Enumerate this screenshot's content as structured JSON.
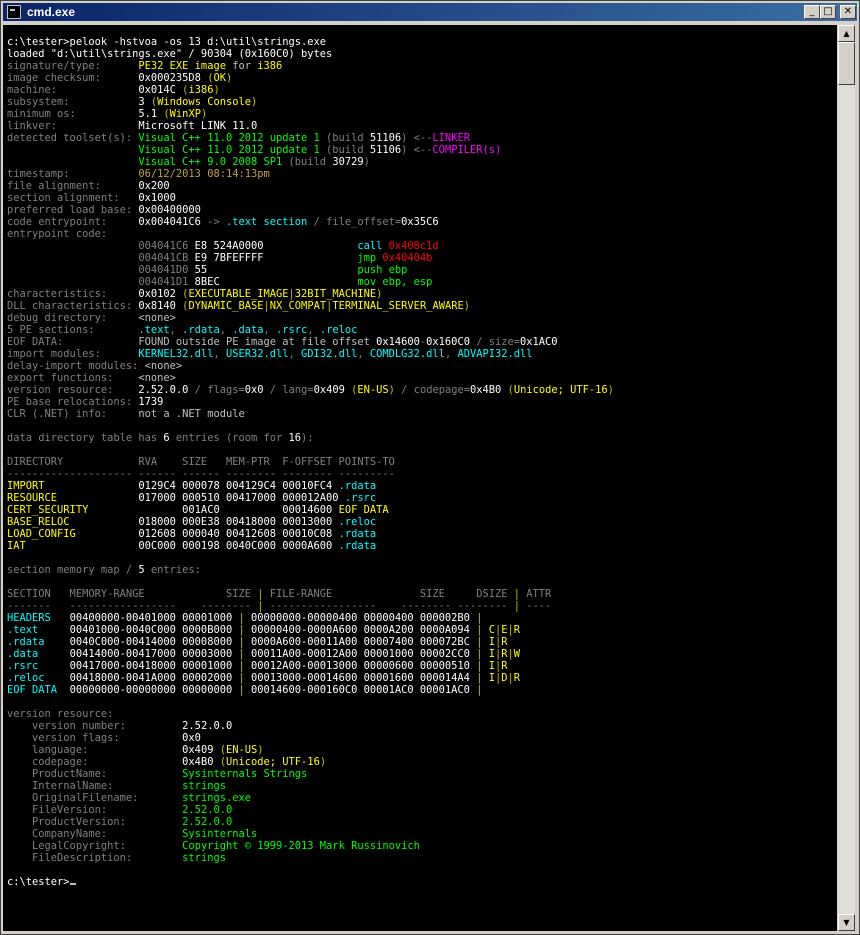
{
  "window": {
    "title": "cmd.exe",
    "min": "_",
    "max": "□",
    "close": "✕"
  },
  "scroll": {
    "up": "▲",
    "down": "▼"
  },
  "console": {
    "prompt": "c:\\tester>",
    "lines": [
      [
        [
          "w",
          "c:\\tester>pelook -hstvoa -os 13 d:\\util\\strings.exe"
        ]
      ],
      [
        [
          "w",
          "loaded \"d:\\util\\strings.exe\" / 90304 (0x160C0) bytes"
        ]
      ],
      [
        [
          "dk",
          "signature/type:      "
        ],
        [
          "y",
          "PE32 EXE image"
        ],
        [
          "g",
          " for "
        ],
        [
          "y",
          "i386"
        ]
      ],
      [
        [
          "dk",
          "image checksum:      "
        ],
        [
          "w",
          "0x000235D8 "
        ],
        [
          "dy",
          "("
        ],
        [
          "y",
          "OK"
        ],
        [
          "dy",
          ")"
        ]
      ],
      [
        [
          "dk",
          "machine:             "
        ],
        [
          "w",
          "0x014C "
        ],
        [
          "dy",
          "("
        ],
        [
          "y",
          "i386"
        ],
        [
          "dy",
          ")"
        ]
      ],
      [
        [
          "dk",
          "subsystem:           "
        ],
        [
          "w",
          "3 "
        ],
        [
          "dy",
          "("
        ],
        [
          "y",
          "Windows Console"
        ],
        [
          "dy",
          ")"
        ]
      ],
      [
        [
          "dk",
          "minimum os:          "
        ],
        [
          "w",
          "5.1 "
        ],
        [
          "dy",
          "("
        ],
        [
          "y",
          "WinXP"
        ],
        [
          "dy",
          ")"
        ]
      ],
      [
        [
          "dk",
          "linkver:             "
        ],
        [
          "w",
          "Microsoft LINK 11.0"
        ]
      ],
      [
        [
          "dk",
          "detected toolset(s): "
        ],
        [
          "lg",
          "Visual C++ 11.0 2012 update 1 "
        ],
        [
          "dk",
          "(build "
        ],
        [
          "w",
          "51106"
        ],
        [
          "dk",
          ") "
        ],
        [
          "dk",
          "<--"
        ],
        [
          "m",
          "LINKER"
        ]
      ],
      [
        [
          "dk",
          "                     "
        ],
        [
          "lg",
          "Visual C++ 11.0 2012 update 1 "
        ],
        [
          "dk",
          "(build "
        ],
        [
          "w",
          "51106"
        ],
        [
          "dk",
          ") "
        ],
        [
          "dk",
          "<--"
        ],
        [
          "m",
          "COMPILER(s)"
        ]
      ],
      [
        [
          "dk",
          "                     "
        ],
        [
          "lg",
          "Visual C++ 9.0 2008 SP1 "
        ],
        [
          "dk",
          "(build "
        ],
        [
          "w",
          "30729"
        ],
        [
          "dk",
          ")"
        ]
      ],
      [
        [
          "dk",
          "timestamp:           "
        ],
        [
          "o",
          "06/12/2013 08:14:13pm"
        ]
      ],
      [
        [
          "dk",
          "file alignment:      "
        ],
        [
          "w",
          "0x200"
        ]
      ],
      [
        [
          "dk",
          "section alignment:   "
        ],
        [
          "w",
          "0x1000"
        ]
      ],
      [
        [
          "dk",
          "preferred load base: "
        ],
        [
          "w",
          "0x00400000"
        ]
      ],
      [
        [
          "dk",
          "code entrypoint:     "
        ],
        [
          "w",
          "0x004041C6 "
        ],
        [
          "dk",
          "-> "
        ],
        [
          "c",
          ".text section"
        ],
        [
          "dk",
          " / file_offset="
        ],
        [
          "w",
          "0x35C6"
        ]
      ],
      [
        [
          "dk",
          "entrypoint code:"
        ]
      ],
      [
        [
          "dk",
          "                     004041C6 "
        ],
        [
          "w",
          "E8 524A0000               "
        ],
        [
          "c",
          "call "
        ],
        [
          "r",
          "0x408c1d"
        ]
      ],
      [
        [
          "dk",
          "                     004041CB "
        ],
        [
          "w",
          "E9 7BFEFFFF               "
        ],
        [
          "lg",
          "jmp "
        ],
        [
          "r",
          "0x40404b"
        ]
      ],
      [
        [
          "dk",
          "                     004041D0 "
        ],
        [
          "w",
          "55                        "
        ],
        [
          "lg",
          "push ebp"
        ]
      ],
      [
        [
          "dk",
          "                     004041D1 "
        ],
        [
          "w",
          "8BEC                      "
        ],
        [
          "lg",
          "mov ebp, esp"
        ]
      ],
      [
        [
          "dk",
          "characteristics:     "
        ],
        [
          "w",
          "0x0102 "
        ],
        [
          "dy",
          "("
        ],
        [
          "y",
          "EXECUTABLE_IMAGE"
        ],
        [
          "dy",
          "|"
        ],
        [
          "y",
          "32BIT_MACHINE"
        ],
        [
          "dy",
          ")"
        ]
      ],
      [
        [
          "dk",
          "DLL characteristics: "
        ],
        [
          "w",
          "0x8140 "
        ],
        [
          "dy",
          "("
        ],
        [
          "y",
          "DYNAMIC_BASE"
        ],
        [
          "dy",
          "|"
        ],
        [
          "y",
          "NX_COMPAT"
        ],
        [
          "dy",
          "|"
        ],
        [
          "y",
          "TERMINAL_SERVER_AWARE"
        ],
        [
          "dy",
          ")"
        ]
      ],
      [
        [
          "dk",
          "debug directory:     "
        ],
        [
          "g",
          "<none>"
        ]
      ],
      [
        [
          "dk",
          "5 PE sections:       "
        ],
        [
          "c",
          ".text"
        ],
        [
          "dk",
          ", "
        ],
        [
          "c",
          ".rdata"
        ],
        [
          "dk",
          ", "
        ],
        [
          "c",
          ".data"
        ],
        [
          "dk",
          ", "
        ],
        [
          "c",
          ".rsrc"
        ],
        [
          "dk",
          ", "
        ],
        [
          "c",
          ".reloc"
        ]
      ],
      [
        [
          "dk",
          "EOF DATA:            "
        ],
        [
          "g",
          "FOUND outside PE image at file offset "
        ],
        [
          "w",
          "0x14600"
        ],
        [
          "dk",
          "-"
        ],
        [
          "w",
          "0x160C0"
        ],
        [
          "dk",
          " / size="
        ],
        [
          "w",
          "0x1AC0"
        ]
      ],
      [
        [
          "dk",
          "import modules:      "
        ],
        [
          "c",
          "KERNEL32.dll"
        ],
        [
          "dk",
          ", "
        ],
        [
          "c",
          "USER32.dll"
        ],
        [
          "dk",
          ", "
        ],
        [
          "c",
          "GDI32.dll"
        ],
        [
          "dk",
          ", "
        ],
        [
          "c",
          "COMDLG32.dll"
        ],
        [
          "dk",
          ", "
        ],
        [
          "c",
          "ADVAPI32.dll"
        ]
      ],
      [
        [
          "dk",
          "delay-import modules: "
        ],
        [
          "g",
          "<none>"
        ]
      ],
      [
        [
          "dk",
          "export functions:    "
        ],
        [
          "g",
          "<none>"
        ]
      ],
      [
        [
          "dk",
          "version resource:    "
        ],
        [
          "w",
          "2.52.0.0"
        ],
        [
          "dk",
          " / flags="
        ],
        [
          "w",
          "0x0"
        ],
        [
          "dk",
          " / lang="
        ],
        [
          "w",
          "0x409 "
        ],
        [
          "dy",
          "("
        ],
        [
          "y",
          "EN-US"
        ],
        [
          "dy",
          ")"
        ],
        [
          "dk",
          " / codepage="
        ],
        [
          "w",
          "0x4B0 "
        ],
        [
          "dy",
          "("
        ],
        [
          "y",
          "Unicode; UTF-16"
        ],
        [
          "dy",
          ")"
        ]
      ],
      [
        [
          "dk",
          "PE base relocations: "
        ],
        [
          "w",
          "1739"
        ]
      ],
      [
        [
          "dk",
          "CLR (.NET) info:     "
        ],
        [
          "g",
          "not a .NET module"
        ]
      ],
      [
        [
          "g",
          ""
        ]
      ],
      [
        [
          "dk",
          "data directory table has "
        ],
        [
          "w",
          "6"
        ],
        [
          "dk",
          " entries (room for "
        ],
        [
          "w",
          "16"
        ],
        [
          "dk",
          "):"
        ]
      ],
      [
        [
          "g",
          ""
        ]
      ],
      [
        [
          "dk",
          "DIRECTORY            RVA    SIZE   MEM-PTR  F-OFFSET POINTS-TO"
        ]
      ],
      [
        [
          "dk",
          "-------------------- ------ ------ -------- -------- ---------"
        ]
      ],
      [
        [
          "y",
          "IMPORT               "
        ],
        [
          "w",
          "0129C4 000078 004129C4 00010FC4 "
        ],
        [
          "c",
          ".rdata"
        ]
      ],
      [
        [
          "y",
          "RESOURCE             "
        ],
        [
          "w",
          "017000 000510 00417000 000012A00 "
        ],
        [
          "c",
          ".rsrc"
        ]
      ],
      [
        [
          "y",
          "CERT_SECURITY        "
        ],
        [
          "w",
          "       001AC0          00014600 "
        ],
        [
          "y",
          "EOF DATA"
        ]
      ],
      [
        [
          "y",
          "BASE_RELOC           "
        ],
        [
          "w",
          "018000 000E38 00418000 00013000 "
        ],
        [
          "c",
          ".reloc"
        ]
      ],
      [
        [
          "y",
          "LOAD_CONFIG          "
        ],
        [
          "w",
          "012608 000040 00412608 00010C08 "
        ],
        [
          "c",
          ".rdata"
        ]
      ],
      [
        [
          "y",
          "IAT                  "
        ],
        [
          "w",
          "00C000 000198 0040C000 0000A600 "
        ],
        [
          "c",
          ".rdata"
        ]
      ],
      [
        [
          "g",
          ""
        ]
      ],
      [
        [
          "dk",
          "section memory map / "
        ],
        [
          "w",
          "5"
        ],
        [
          "dk",
          " entries:"
        ]
      ],
      [
        [
          "g",
          ""
        ]
      ],
      [
        [
          "dk",
          "SECTION   MEMORY-RANGE             SIZE "
        ],
        [
          "dy",
          "|"
        ],
        [
          "dk",
          " FILE-RANGE              SIZE     DSIZE "
        ],
        [
          "dy",
          "|"
        ],
        [
          "dk",
          " ATTR"
        ]
      ],
      [
        [
          "dk",
          "-------   -----------------    -------- "
        ],
        [
          "dy",
          "|"
        ],
        [
          "dk",
          " -----------------    -------- -------- "
        ],
        [
          "dy",
          "|"
        ],
        [
          "dk",
          " ----"
        ]
      ],
      [
        [
          "c",
          "HEADERS   "
        ],
        [
          "w",
          "00400000-00401000 00001000 "
        ],
        [
          "dy",
          "|"
        ],
        [
          "w",
          " 00000000-00000400 00000400 000002B0 "
        ],
        [
          "dy",
          "|"
        ]
      ],
      [
        [
          "c",
          ".text     "
        ],
        [
          "w",
          "00401000-0040C000 0000B000 "
        ],
        [
          "dy",
          "|"
        ],
        [
          "w",
          " 00000400-0000A600 0000A200 0000A094 "
        ],
        [
          "dy",
          "|"
        ],
        [
          "y",
          " C"
        ],
        [
          "dy",
          "|"
        ],
        [
          "y",
          "E"
        ],
        [
          "dy",
          "|"
        ],
        [
          "y",
          "R"
        ]
      ],
      [
        [
          "c",
          ".rdata    "
        ],
        [
          "w",
          "0040C000-00414000 00008000 "
        ],
        [
          "dy",
          "|"
        ],
        [
          "w",
          " 0000A600-00011A00 00007400 000072BC "
        ],
        [
          "dy",
          "|"
        ],
        [
          "y",
          " I"
        ],
        [
          "dy",
          "|"
        ],
        [
          "y",
          "R"
        ]
      ],
      [
        [
          "c",
          ".data     "
        ],
        [
          "w",
          "00414000-00417000 00003000 "
        ],
        [
          "dy",
          "|"
        ],
        [
          "w",
          " 00011A00-00012A00 00001000 00002CC0 "
        ],
        [
          "dy",
          "|"
        ],
        [
          "y",
          " I"
        ],
        [
          "dy",
          "|"
        ],
        [
          "y",
          "R"
        ],
        [
          "dy",
          "|"
        ],
        [
          "y",
          "W"
        ]
      ],
      [
        [
          "c",
          ".rsrc     "
        ],
        [
          "w",
          "00417000-00418000 00001000 "
        ],
        [
          "dy",
          "|"
        ],
        [
          "w",
          " 00012A00-00013000 00000600 00000510 "
        ],
        [
          "dy",
          "|"
        ],
        [
          "y",
          " I"
        ],
        [
          "dy",
          "|"
        ],
        [
          "y",
          "R"
        ]
      ],
      [
        [
          "c",
          ".reloc    "
        ],
        [
          "w",
          "00418000-0041A000 00002000 "
        ],
        [
          "dy",
          "|"
        ],
        [
          "w",
          " 00013000-00014600 00001600 000014A4 "
        ],
        [
          "dy",
          "|"
        ],
        [
          "y",
          " I"
        ],
        [
          "dy",
          "|"
        ],
        [
          "y",
          "D"
        ],
        [
          "dy",
          "|"
        ],
        [
          "y",
          "R"
        ]
      ],
      [
        [
          "c",
          "EOF DATA  "
        ],
        [
          "w",
          "00000000-00000000 00000000 "
        ],
        [
          "dy",
          "|"
        ],
        [
          "w",
          " 00014600-000160C0 00001AC0 00001AC0 "
        ],
        [
          "dy",
          "|"
        ]
      ],
      [
        [
          "g",
          ""
        ]
      ],
      [
        [
          "dk",
          "version resource:"
        ]
      ],
      [
        [
          "dk",
          "    version number:         "
        ],
        [
          "w",
          "2.52.0.0"
        ]
      ],
      [
        [
          "dk",
          "    version flags:          "
        ],
        [
          "w",
          "0x0"
        ]
      ],
      [
        [
          "dk",
          "    language:               "
        ],
        [
          "w",
          "0x409 "
        ],
        [
          "dy",
          "("
        ],
        [
          "y",
          "EN-US"
        ],
        [
          "dy",
          ")"
        ]
      ],
      [
        [
          "dk",
          "    codepage:               "
        ],
        [
          "w",
          "0x4B0 "
        ],
        [
          "dy",
          "("
        ],
        [
          "y",
          "Unicode; UTF-16"
        ],
        [
          "dy",
          ")"
        ]
      ],
      [
        [
          "dk",
          "    ProductName:            "
        ],
        [
          "lg",
          "Sysinternals Strings"
        ]
      ],
      [
        [
          "dk",
          "    InternalName:           "
        ],
        [
          "lg",
          "strings"
        ]
      ],
      [
        [
          "dk",
          "    OriginalFilename:       "
        ],
        [
          "lg",
          "strings.exe"
        ]
      ],
      [
        [
          "dk",
          "    FileVersion:            "
        ],
        [
          "lg",
          "2.52.0.0"
        ]
      ],
      [
        [
          "dk",
          "    ProductVersion:         "
        ],
        [
          "lg",
          "2.52.0.0"
        ]
      ],
      [
        [
          "dk",
          "    CompanyName:            "
        ],
        [
          "lg",
          "Sysinternals"
        ]
      ],
      [
        [
          "dk",
          "    LegalCopyright:         "
        ],
        [
          "lg",
          "Copyright © 1999-2013 Mark Russinovich"
        ]
      ],
      [
        [
          "dk",
          "    FileDescription:        "
        ],
        [
          "lg",
          "strings"
        ]
      ],
      [
        [
          "g",
          ""
        ]
      ]
    ]
  }
}
